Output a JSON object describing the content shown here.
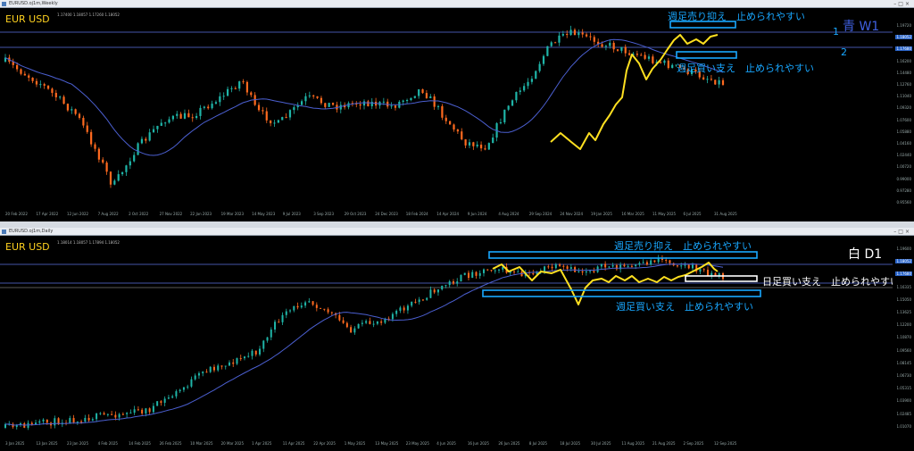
{
  "colors": {
    "bull": "#1fb5a8",
    "bear": "#ff6a1f",
    "ma": "#4b5fd0",
    "zigzag": "#ffe020",
    "box": "#18a7ff",
    "white": "#ffffff",
    "grid": "#5b6fe0"
  },
  "top": {
    "title": "EURUSD.oj1m,Weekly",
    "symbol": "EUR USD",
    "ohlc": "1.17400 1.18057 1.17260 1.18052",
    "timeframe": "青 W1",
    "level_1": "1",
    "level_2": "2",
    "anno_resist": "週足売り抑え　止められやすい",
    "anno_support": "週足買い支え　止められやすい",
    "price_labels": [
      "1.19720",
      "1.18052",
      "1.17680",
      "1.16200",
      "1.14480",
      "1.12760",
      "1.11040",
      "1.09320",
      "1.07600",
      "1.05880",
      "1.04160",
      "1.02440",
      "1.00720",
      "0.99000",
      "0.97280",
      "0.95560"
    ],
    "dates": [
      "20 Feb 2022",
      "17 Apr 2022",
      "12 Jun 2022",
      "7 Aug 2022",
      "2 Oct 2022",
      "27 Nov 2022",
      "22 Jan 2023",
      "19 Mar 2023",
      "14 May 2023",
      "9 Jul 2023",
      "3 Sep 2023",
      "29 Oct 2023",
      "24 Dec 2023",
      "18 Feb 2024",
      "14 Apr 2024",
      "9 Jun 2024",
      "4 Aug 2024",
      "29 Sep 2024",
      "24 Nov 2024",
      "19 Jan 2025",
      "16 Mar 2025",
      "11 May 2025",
      "6 Jul 2025",
      "31 Aug 2025"
    ]
  },
  "bottom": {
    "title": "EURUSD.oj1m,Daily",
    "symbol": "EUR USD",
    "ohlc": "1.18014 1.18057 1.17894 1.18052",
    "timeframe": "白 D1",
    "anno_resist": "週足売り抑え　止められやすい",
    "anno_support": "週足買い支え　止められやすい",
    "anno_daily": "日足買い支え　止められやすい",
    "price_labels": [
      "1.19600",
      "1.18052",
      "1.17680",
      "1.16335",
      "1.15050",
      "1.13625",
      "1.12200",
      "1.10870",
      "1.09560",
      "1.08145",
      "1.06730",
      "1.05315",
      "1.03900",
      "1.02485",
      "1.01070"
    ],
    "dates": [
      "3 Jan 2025",
      "13 Jan 2025",
      "23 Jan 2025",
      "4 Feb 2025",
      "14 Feb 2025",
      "26 Feb 2025",
      "10 Mar 2025",
      "20 Mar 2025",
      "1 Apr 2025",
      "11 Apr 2025",
      "22 Apr 2025",
      "1 May 2025",
      "13 May 2025",
      "23 May 2025",
      "4 Jun 2025",
      "16 Jun 2025",
      "26 Jun 2025",
      "8 Jul 2025",
      "18 Jul 2025",
      "30 Jul 2025",
      "11 Aug 2025",
      "21 Aug 2025",
      "2 Sep 2025",
      "12 Sep 2025"
    ]
  }
}
